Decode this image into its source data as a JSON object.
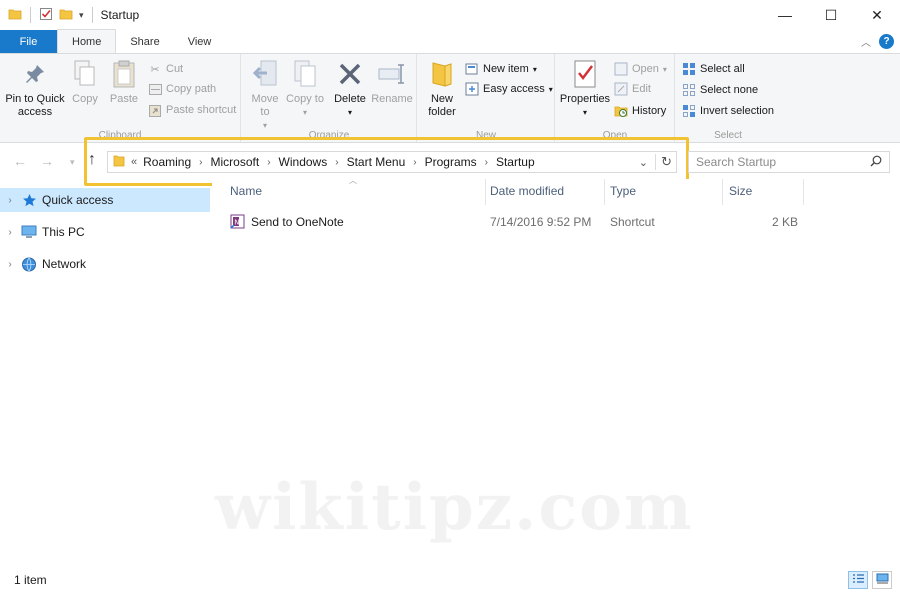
{
  "title": "Startup",
  "window_controls": {
    "minimize": "—",
    "maximize": "☐",
    "close": "✕"
  },
  "tabs": [
    "File",
    "Home",
    "Share",
    "View"
  ],
  "ribbon": {
    "clipboard": {
      "label": "Clipboard",
      "pin": "Pin to Quick access",
      "copy": "Copy",
      "paste": "Paste",
      "cut": "Cut",
      "copy_path": "Copy path",
      "paste_shortcut": "Paste shortcut"
    },
    "organize": {
      "label": "Organize",
      "move_to": "Move to",
      "copy_to": "Copy to",
      "delete": "Delete",
      "rename": "Rename"
    },
    "new": {
      "label": "New",
      "new_folder": "New folder",
      "new_item": "New item",
      "easy_access": "Easy access"
    },
    "open": {
      "label": "Open",
      "properties": "Properties",
      "open": "Open",
      "edit": "Edit",
      "history": "History"
    },
    "select": {
      "label": "Select",
      "select_all": "Select all",
      "select_none": "Select none",
      "invert": "Invert selection"
    }
  },
  "address": {
    "overflow": "«",
    "crumbs": [
      "Roaming",
      "Microsoft",
      "Windows",
      "Start Menu",
      "Programs",
      "Startup"
    ]
  },
  "search": {
    "placeholder": "Search Startup"
  },
  "nav_pane": {
    "items": [
      {
        "label": "Quick access",
        "selected": true
      },
      {
        "label": "This PC",
        "selected": false
      },
      {
        "label": "Network",
        "selected": false
      }
    ]
  },
  "columns": [
    "Name",
    "Date modified",
    "Type",
    "Size"
  ],
  "files": [
    {
      "name": "Send to OneNote",
      "date": "7/14/2016 9:52 PM",
      "type": "Shortcut",
      "size": "2 KB"
    }
  ],
  "watermark": "wikitipz.com",
  "status": {
    "count": "1 item"
  },
  "colors": {
    "accent": "#1979ca",
    "highlight": "#f1c232",
    "selected": "#cce8ff"
  }
}
